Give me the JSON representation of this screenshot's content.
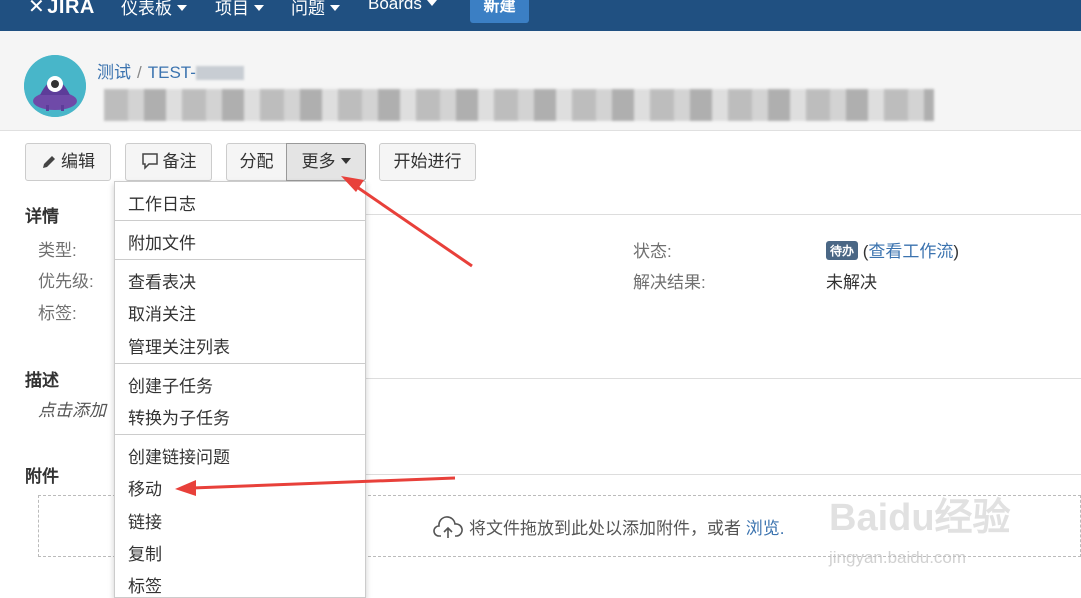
{
  "nav": {
    "logo": "JIRA",
    "items": [
      {
        "label": "仪表板"
      },
      {
        "label": "项目"
      },
      {
        "label": "问题"
      },
      {
        "label": "Boards"
      }
    ],
    "create_label": "新建"
  },
  "header": {
    "project": "测试",
    "issue_key_prefix": "TEST-"
  },
  "toolbar": {
    "edit": "编辑",
    "comment": "备注",
    "assign": "分配",
    "more": "更多",
    "start": "开始进行"
  },
  "details": {
    "heading": "详情",
    "type_label": "类型:",
    "priority_label": "优先级:",
    "labels_label": "标签:",
    "status_label": "状态:",
    "status_badge": "待办",
    "view_workflow": "查看工作流",
    "resolution_label": "解决结果:",
    "resolution_value": "未解决"
  },
  "description": {
    "heading": "描述",
    "placeholder": "点击添加"
  },
  "attachments": {
    "heading": "附件",
    "drop_text": "将文件拖放到此处以添加附件，或者",
    "browse": "浏览."
  },
  "more_menu": {
    "items": [
      "工作日志",
      "附加文件",
      "查看表决",
      "取消关注",
      "管理关注列表",
      "创建子任务",
      "转换为子任务",
      "创建链接问题",
      "移动",
      "链接",
      "复制",
      "标签"
    ]
  },
  "watermark": {
    "brand": "Baidu经验",
    "url": "jingyan.baidu.com"
  },
  "colors": {
    "nav_bg": "#205081",
    "create_bg": "#3b7fc4",
    "link": "#3b73af",
    "badge": "#4a6785",
    "arrow": "#e8403a"
  }
}
